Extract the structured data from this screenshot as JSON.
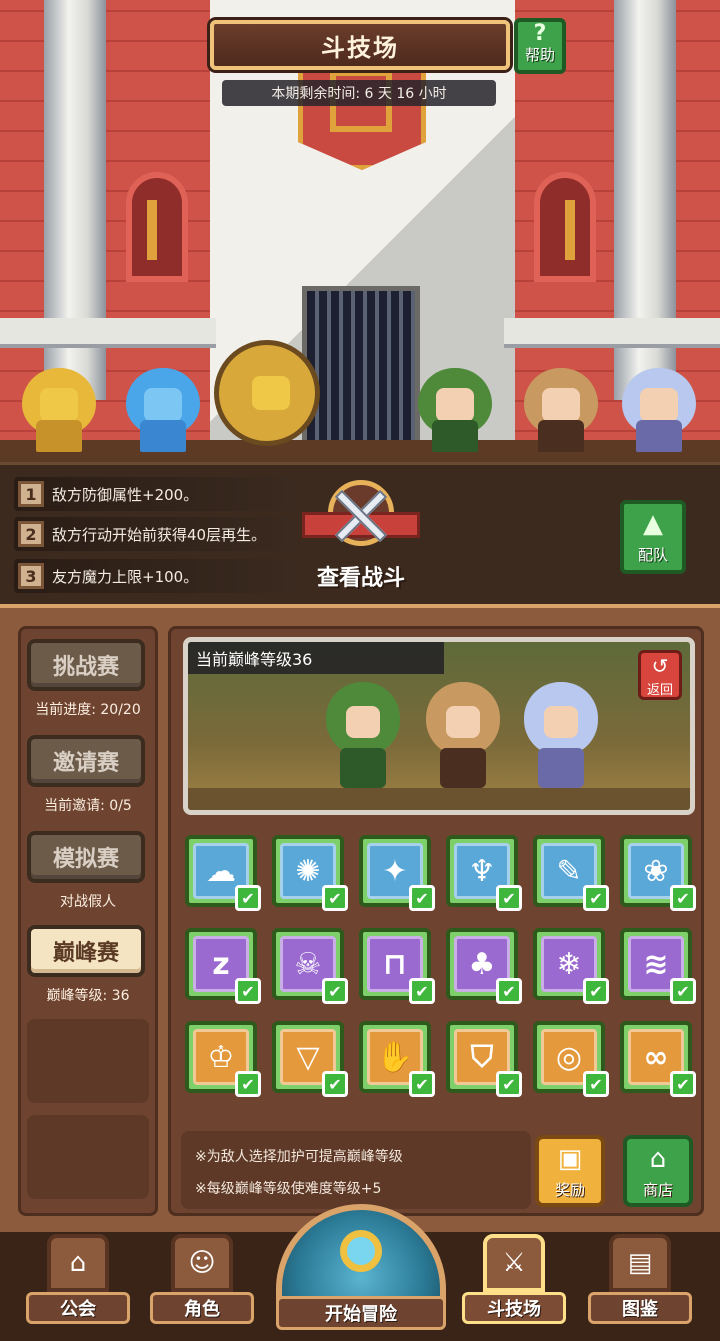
{
  "header": {
    "title": "斗技场",
    "help_label": "帮助",
    "help_icon": "question-icon",
    "timer_text": "本期剩余时间: 6 天 16 小时"
  },
  "buffs": [
    {
      "num": "1",
      "text": "敌方防御属性+200。"
    },
    {
      "num": "2",
      "text": "敌方行动开始前获得40层再生。"
    },
    {
      "num": "3",
      "text": "友方魔力上限+100。"
    }
  ],
  "view_battle_label": "查看战斗",
  "team_button_label": "配队",
  "modes": [
    {
      "label": "挑战赛",
      "sub": "当前进度: 20/20",
      "active": false
    },
    {
      "label": "邀请赛",
      "sub": "当前邀请: 0/5",
      "active": false
    },
    {
      "label": "模拟赛",
      "sub": "对战假人",
      "active": false
    },
    {
      "label": "巅峰赛",
      "sub": "巅峰等级: 36",
      "active": true
    }
  ],
  "preview": {
    "title": "当前巅峰等级36",
    "back_label": "返回"
  },
  "modifiers": [
    {
      "icon": "cloud-icon",
      "glyph": "☁",
      "color": "#5aa8d8"
    },
    {
      "icon": "gear-icon",
      "glyph": "✺",
      "color": "#5aa8d8"
    },
    {
      "icon": "sparkle-icon",
      "glyph": "✦",
      "color": "#5aa8d8"
    },
    {
      "icon": "wings-icon",
      "glyph": "♆",
      "color": "#5aa8d8"
    },
    {
      "icon": "feather-icon",
      "glyph": "✎",
      "color": "#5aa8d8"
    },
    {
      "icon": "paw-icon",
      "glyph": "❀",
      "color": "#5aa8d8"
    },
    {
      "icon": "sleep-icon",
      "glyph": "z",
      "color": "#9a6ad0"
    },
    {
      "icon": "skull-icon",
      "glyph": "☠",
      "color": "#9a6ad0"
    },
    {
      "icon": "tombstone-icon",
      "glyph": "⊓",
      "color": "#9a6ad0"
    },
    {
      "icon": "mushroom-icon",
      "glyph": "♣",
      "color": "#9a6ad0"
    },
    {
      "icon": "snowflake-icon",
      "glyph": "❄",
      "color": "#9a6ad0"
    },
    {
      "icon": "wave-icon",
      "glyph": "≋",
      "color": "#9a6ad0"
    },
    {
      "icon": "claw-icon",
      "glyph": "♔",
      "color": "#e49a3c"
    },
    {
      "icon": "fang-icon",
      "glyph": "▽",
      "color": "#e49a3c"
    },
    {
      "icon": "fist-icon",
      "glyph": "✋",
      "color": "#e49a3c"
    },
    {
      "icon": "shield-icon",
      "glyph": "⛉",
      "color": "#e49a3c"
    },
    {
      "icon": "spiral-icon",
      "glyph": "◎",
      "color": "#e49a3c"
    },
    {
      "icon": "infinity-icon",
      "glyph": "∞",
      "color": "#e49a3c"
    }
  ],
  "notes": [
    "※为敌人选择加护可提高巅峰等级",
    "※每级巅峰等级使难度等级+5"
  ],
  "reward_label": "奖励",
  "shop_label": "商店",
  "nav": {
    "guild": "公会",
    "character": "角色",
    "adventure": "开始冒险",
    "arena": "斗技场",
    "codex": "图鉴"
  }
}
